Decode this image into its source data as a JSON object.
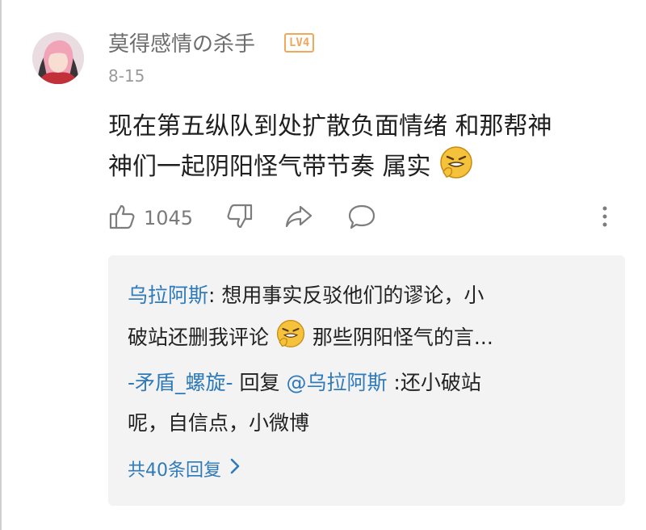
{
  "comment": {
    "username": "莫得感情の杀手",
    "level_badge": "LV4",
    "date": "8-15",
    "text_line1": "现在第五纵队到处扩散负面情绪 和那帮神",
    "text_line2": "神们一起阴阳怪气带节奏  属实",
    "like_count": "1045"
  },
  "replies": {
    "r1_user": "乌拉阿斯",
    "r1_text_line1": ": 想用事实反驳他们的谬论，小",
    "r1_text_line2_a": "破站还删我评论",
    "r1_text_line2_b": "那些阴阳怪气的言...",
    "r2_user": "-矛盾_螺旋-",
    "r2_reply_word": " 回复 ",
    "r2_mention": "@乌拉阿斯",
    "r2_text_line1": " :还小破站",
    "r2_text_line2": "呢，自信点，小微博",
    "more_label": "共40条回复"
  },
  "icons": {
    "like": "thumbs-up-icon",
    "dislike": "thumbs-down-icon",
    "share": "share-icon",
    "reply": "comment-icon",
    "more": "more-vertical-icon",
    "emoji": "grimace-emoji-icon"
  },
  "colors": {
    "link": "#2f7ab8",
    "badge": "#f0a85a",
    "reply_bg": "#f3f3f3"
  }
}
